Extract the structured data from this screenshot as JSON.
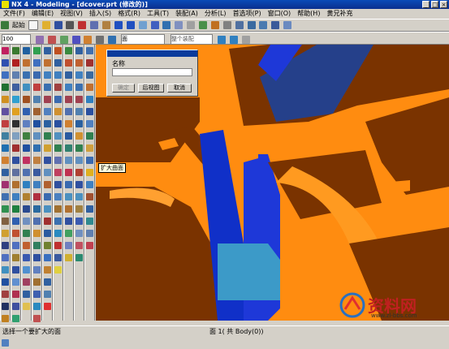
{
  "window": {
    "title": "NX 4 - Modeling - [dcover.prt (修改的)]",
    "buttons": [
      "_",
      "□",
      "×"
    ]
  },
  "menu": [
    "文件(F)",
    "编辑(E)",
    "视图(V)",
    "插入(S)",
    "格式(R)",
    "工具(T)",
    "装配(A)",
    "分析(L)",
    "首选项(P)",
    "窗口(O)",
    "帮助(H)",
    "黄兄补充"
  ],
  "toolbar": {
    "start_label": "起始",
    "zoom_value": "100",
    "filter_value": "面",
    "snap_value": "整个装配"
  },
  "dialog": {
    "field_label": "名称",
    "name_value": "",
    "ok_label": "确定",
    "back_label": "后视图",
    "cancel_label": "取消"
  },
  "tooltip": "扩大曲面",
  "status": {
    "prompt": "选择一个要扩大的面",
    "info": "面 1( 共 Body(0))"
  },
  "watermark": {
    "text": "资料网",
    "url": "www.zl-bbs.com"
  },
  "colors": {
    "model_orange": "#ff8c10",
    "model_brown": "#7a3300",
    "model_blue": "#1e38d8",
    "model_navy": "#25408a",
    "model_cyan": "#3c9ac8"
  }
}
